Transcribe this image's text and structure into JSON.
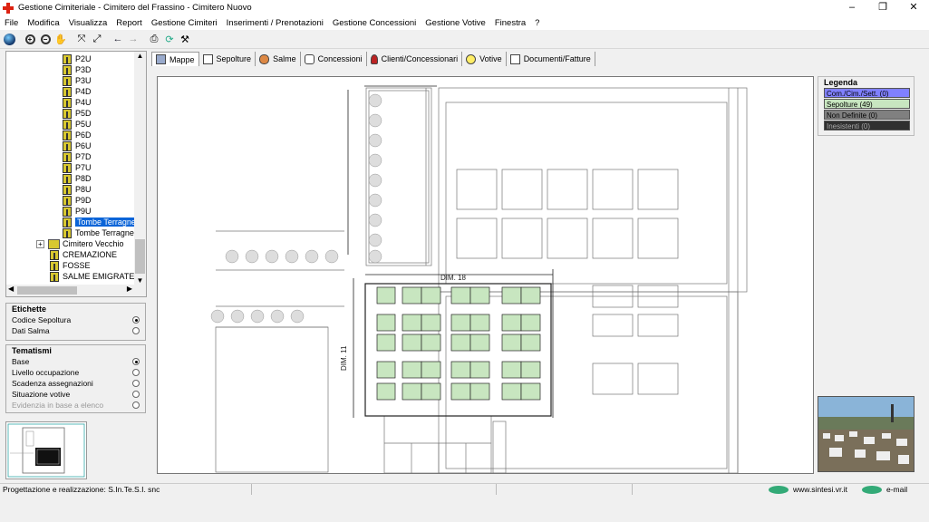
{
  "window": {
    "title": "Gestione Cimiteriale - Cimitero del Frassino - Cimitero Nuovo",
    "buttons": [
      "–",
      "❐",
      "✕"
    ]
  },
  "menu": [
    "File",
    "Modifica",
    "Visualizza",
    "Report",
    "Gestione Cimiteri",
    "Inserimenti / Prenotazioni",
    "Gestione Concessioni",
    "Gestione Votive",
    "Finestra",
    "?"
  ],
  "toolbar": {
    "icons": [
      "globe-icon",
      "zoom-in-icon",
      "zoom-out-icon",
      "pan-hand-icon",
      "fit-all-icon",
      "fit-window-icon",
      "back-arrow-icon",
      "forward-arrow-icon",
      "print-icon",
      "refresh-icon",
      "tools-icon"
    ]
  },
  "tree": {
    "items": [
      "P2U",
      "P3D",
      "P3U",
      "P4D",
      "P4U",
      "P5D",
      "P5U",
      "P6D",
      "P6U",
      "P7D",
      "P7U",
      "P8D",
      "P8U",
      "P9D",
      "P9U"
    ],
    "selected": "Tombe Terragne C",
    "after_selected": "Tombe Terragne C",
    "cimitero_vecchio": "Cimitero Vecchio",
    "cremazione": "CREMAZIONE",
    "fosse": "FOSSE",
    "salme_emigrate": "SALME EMIGRATE"
  },
  "etichette": {
    "title": "Etichette",
    "options": [
      {
        "label": "Codice Sepoltura",
        "selected": true
      },
      {
        "label": "Dati Salma",
        "selected": false
      }
    ]
  },
  "tematismi": {
    "title": "Tematismi",
    "options": [
      {
        "label": "Base",
        "selected": true
      },
      {
        "label": "Livello occupazione",
        "selected": false
      },
      {
        "label": "Scadenza assegnazioni",
        "selected": false
      },
      {
        "label": "Situazione votive",
        "selected": false
      },
      {
        "label": "Evidenzia in base a elenco",
        "selected": false,
        "disabled": true
      }
    ]
  },
  "tabs": [
    "Mappe",
    "Sepolture",
    "Salme",
    "Concessioni",
    "Clienti/Concessionari",
    "Votive",
    "Documenti/Fatture"
  ],
  "map": {
    "dim_top": "DIM. 18",
    "dim_left": "DIM. 11"
  },
  "legend": {
    "title": "Legenda",
    "rows": [
      {
        "label": "Com./Cim./Sett. (0)",
        "color": "#8080ff"
      },
      {
        "label": "Sepolture (49)",
        "color": "#c8e6c0"
      },
      {
        "label": "Non Definite (0)",
        "color": "#808080"
      },
      {
        "label": "Inesistenti (0)",
        "color": "#303030"
      }
    ]
  },
  "status": {
    "credits": "Progettazione e realizzazione: S.In.Te.S.I. snc",
    "website": "www.sintesi.vr.it",
    "email": "e-mail"
  }
}
